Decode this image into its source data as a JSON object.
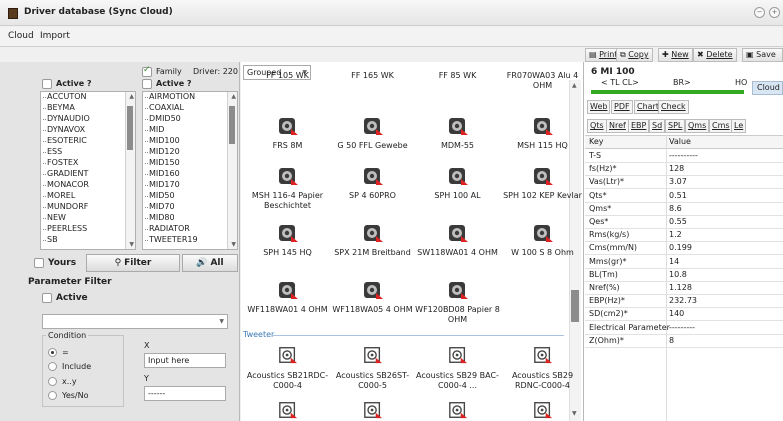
{
  "window": {
    "title": "Driver database (Sync Cloud)"
  },
  "menu": [
    "Cloud",
    "Import"
  ],
  "left_panel": {
    "active_label": "Active ?",
    "family_label": "Family",
    "driver_count": "Driver: 220",
    "active2_label": "Active ?",
    "brands": [
      "ACCUTON",
      "BEYMA",
      "DYNAUDIO",
      "DYNAVOX",
      "ESOTERIC",
      "ESS",
      "FOSTEX",
      "GRADIENT",
      "MONACOR",
      "MOREL",
      "MUNDORF",
      "NEW",
      "PEERLESS",
      "SB"
    ],
    "families": [
      "AIRMOTION",
      "COAXIAL",
      "DMID50",
      "MID",
      "MID100",
      "MID120",
      "MID150",
      "MID160",
      "MID170",
      "MID50",
      "MID70",
      "MID80",
      "RADIATOR",
      "TWEETER19"
    ],
    "yours_label": "Yours",
    "filter_label": "Filter",
    "all_label": "All",
    "param_filter_label": "Parameter Filter",
    "param_active_label": "Active",
    "condition_label": "Condition",
    "radio_options": [
      "=",
      "Include",
      "x..y",
      "Yes/No"
    ],
    "x_label": "X",
    "x_placeholder": "Input here",
    "y_label": "Y",
    "y_value": "------"
  },
  "middle": {
    "group_select": "Grouped",
    "section_label": "Tweeter",
    "rows": [
      [
        "FF 105 WK",
        "FF 165 WK",
        "FF 85 WK",
        "FR070WA03 Alu 4 OHM"
      ],
      [
        "FRS 8M",
        "G 50 FFL Gewebe",
        "MDM-55",
        "MSH 115 HQ"
      ],
      [
        "MSH 116-4 Papier Beschichtet",
        "SP 4 60PRO",
        "SPH 100 AL",
        "SPH 102 KEP Kevlar"
      ],
      [
        "SPH 145 HQ",
        "SPX 21M Breitband",
        "SW118WA01 4 OHM",
        "W 100 S 8 Ohm"
      ],
      [
        "WF118WA01 4 OHM",
        "WF118WA05 4 OHM",
        "WF120BD08 Papier 8 OHM"
      ]
    ],
    "tweeter_row": [
      "Acoustics SB21RDC-C000-4",
      "Acoustics SB26ST-C000-5",
      "Acoustics SB29 BAC-C000-4 ...",
      "Acoustics SB29 RDNC-C000-4"
    ]
  },
  "toolbar": {
    "print": "Print",
    "copy": "Copy",
    "new": "New",
    "delete": "Delete",
    "save": "Save"
  },
  "right_panel": {
    "driver_name": "6 MI 100",
    "tl_cl": "< TL CL>",
    "br": "BR>",
    "ho": "HO",
    "cloud": "Cloud",
    "tabs1": [
      "Web",
      "PDF",
      "Chart",
      "Check"
    ],
    "tabs2": [
      "Qts",
      "Nref",
      "EBP",
      "Sd",
      "SPL",
      "Qms",
      "Cms",
      "Le"
    ],
    "table_header": {
      "key": "Key",
      "value": "Value"
    },
    "rows": [
      {
        "key": "T-S",
        "value": "----------"
      },
      {
        "key": "fs(Hz)*",
        "value": "128"
      },
      {
        "key": "Vas(Ltr)*",
        "value": "3.07"
      },
      {
        "key": "Qts*",
        "value": "0.51"
      },
      {
        "key": "Qms*",
        "value": "8.6"
      },
      {
        "key": "Qes*",
        "value": "0.55"
      },
      {
        "key": "Rms(kg/s)",
        "value": "1.2"
      },
      {
        "key": "Cms(mm/N)",
        "value": "0.199"
      },
      {
        "key": "Mms(gr)*",
        "value": "14"
      },
      {
        "key": "BL(Tm)",
        "value": "10.8"
      },
      {
        "key": "Nref(%)",
        "value": "1.128"
      },
      {
        "key": "EBP(Hz)*",
        "value": "232.73"
      },
      {
        "key": "SD(cm2)*",
        "value": "140"
      },
      {
        "key": "Electrical Parameter",
        "value": "---------"
      },
      {
        "key": "Z(Ohm)*",
        "value": "8"
      }
    ]
  },
  "colors": {
    "accent_green": "#33aa22",
    "cloud_btn": "#d8e6f4"
  }
}
